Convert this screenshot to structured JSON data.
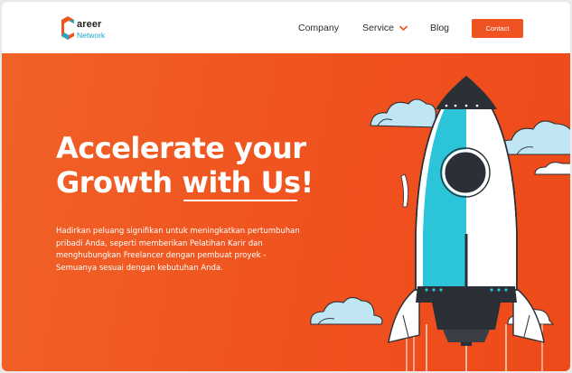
{
  "header": {
    "logo": {
      "word": "areer",
      "sub": "Network"
    },
    "nav": {
      "company": "Company",
      "service": "Service",
      "blog": "Blog"
    },
    "contact_label": "Contact"
  },
  "hero": {
    "headline_line1": "Accelerate your",
    "headline_line2_a": "Growth ",
    "headline_line2_b": "with Us",
    "headline_line2_c": "!",
    "paragraph": "Hadirkan peluang signifikan untuk meningkatkan pertumbuhan pribadi Anda, seperti memberikan Pelatihan Karir dan menghubungkan Freelancer dengan pembuat proyek - Semuanya sesuai dengan kebutuhan Anda."
  },
  "colors": {
    "accent": "#f05322",
    "logo_orange": "#f05322",
    "logo_blue": "#20a8c8",
    "rocket_cyan": "#2bc4d8",
    "cloud_blue": "#bfe6f2",
    "dark": "#2b2f36"
  },
  "icons": {
    "service_chevron": "chevron-down-icon",
    "logo": "career-network-logo-icon",
    "illustration": "rocket-illustration"
  }
}
